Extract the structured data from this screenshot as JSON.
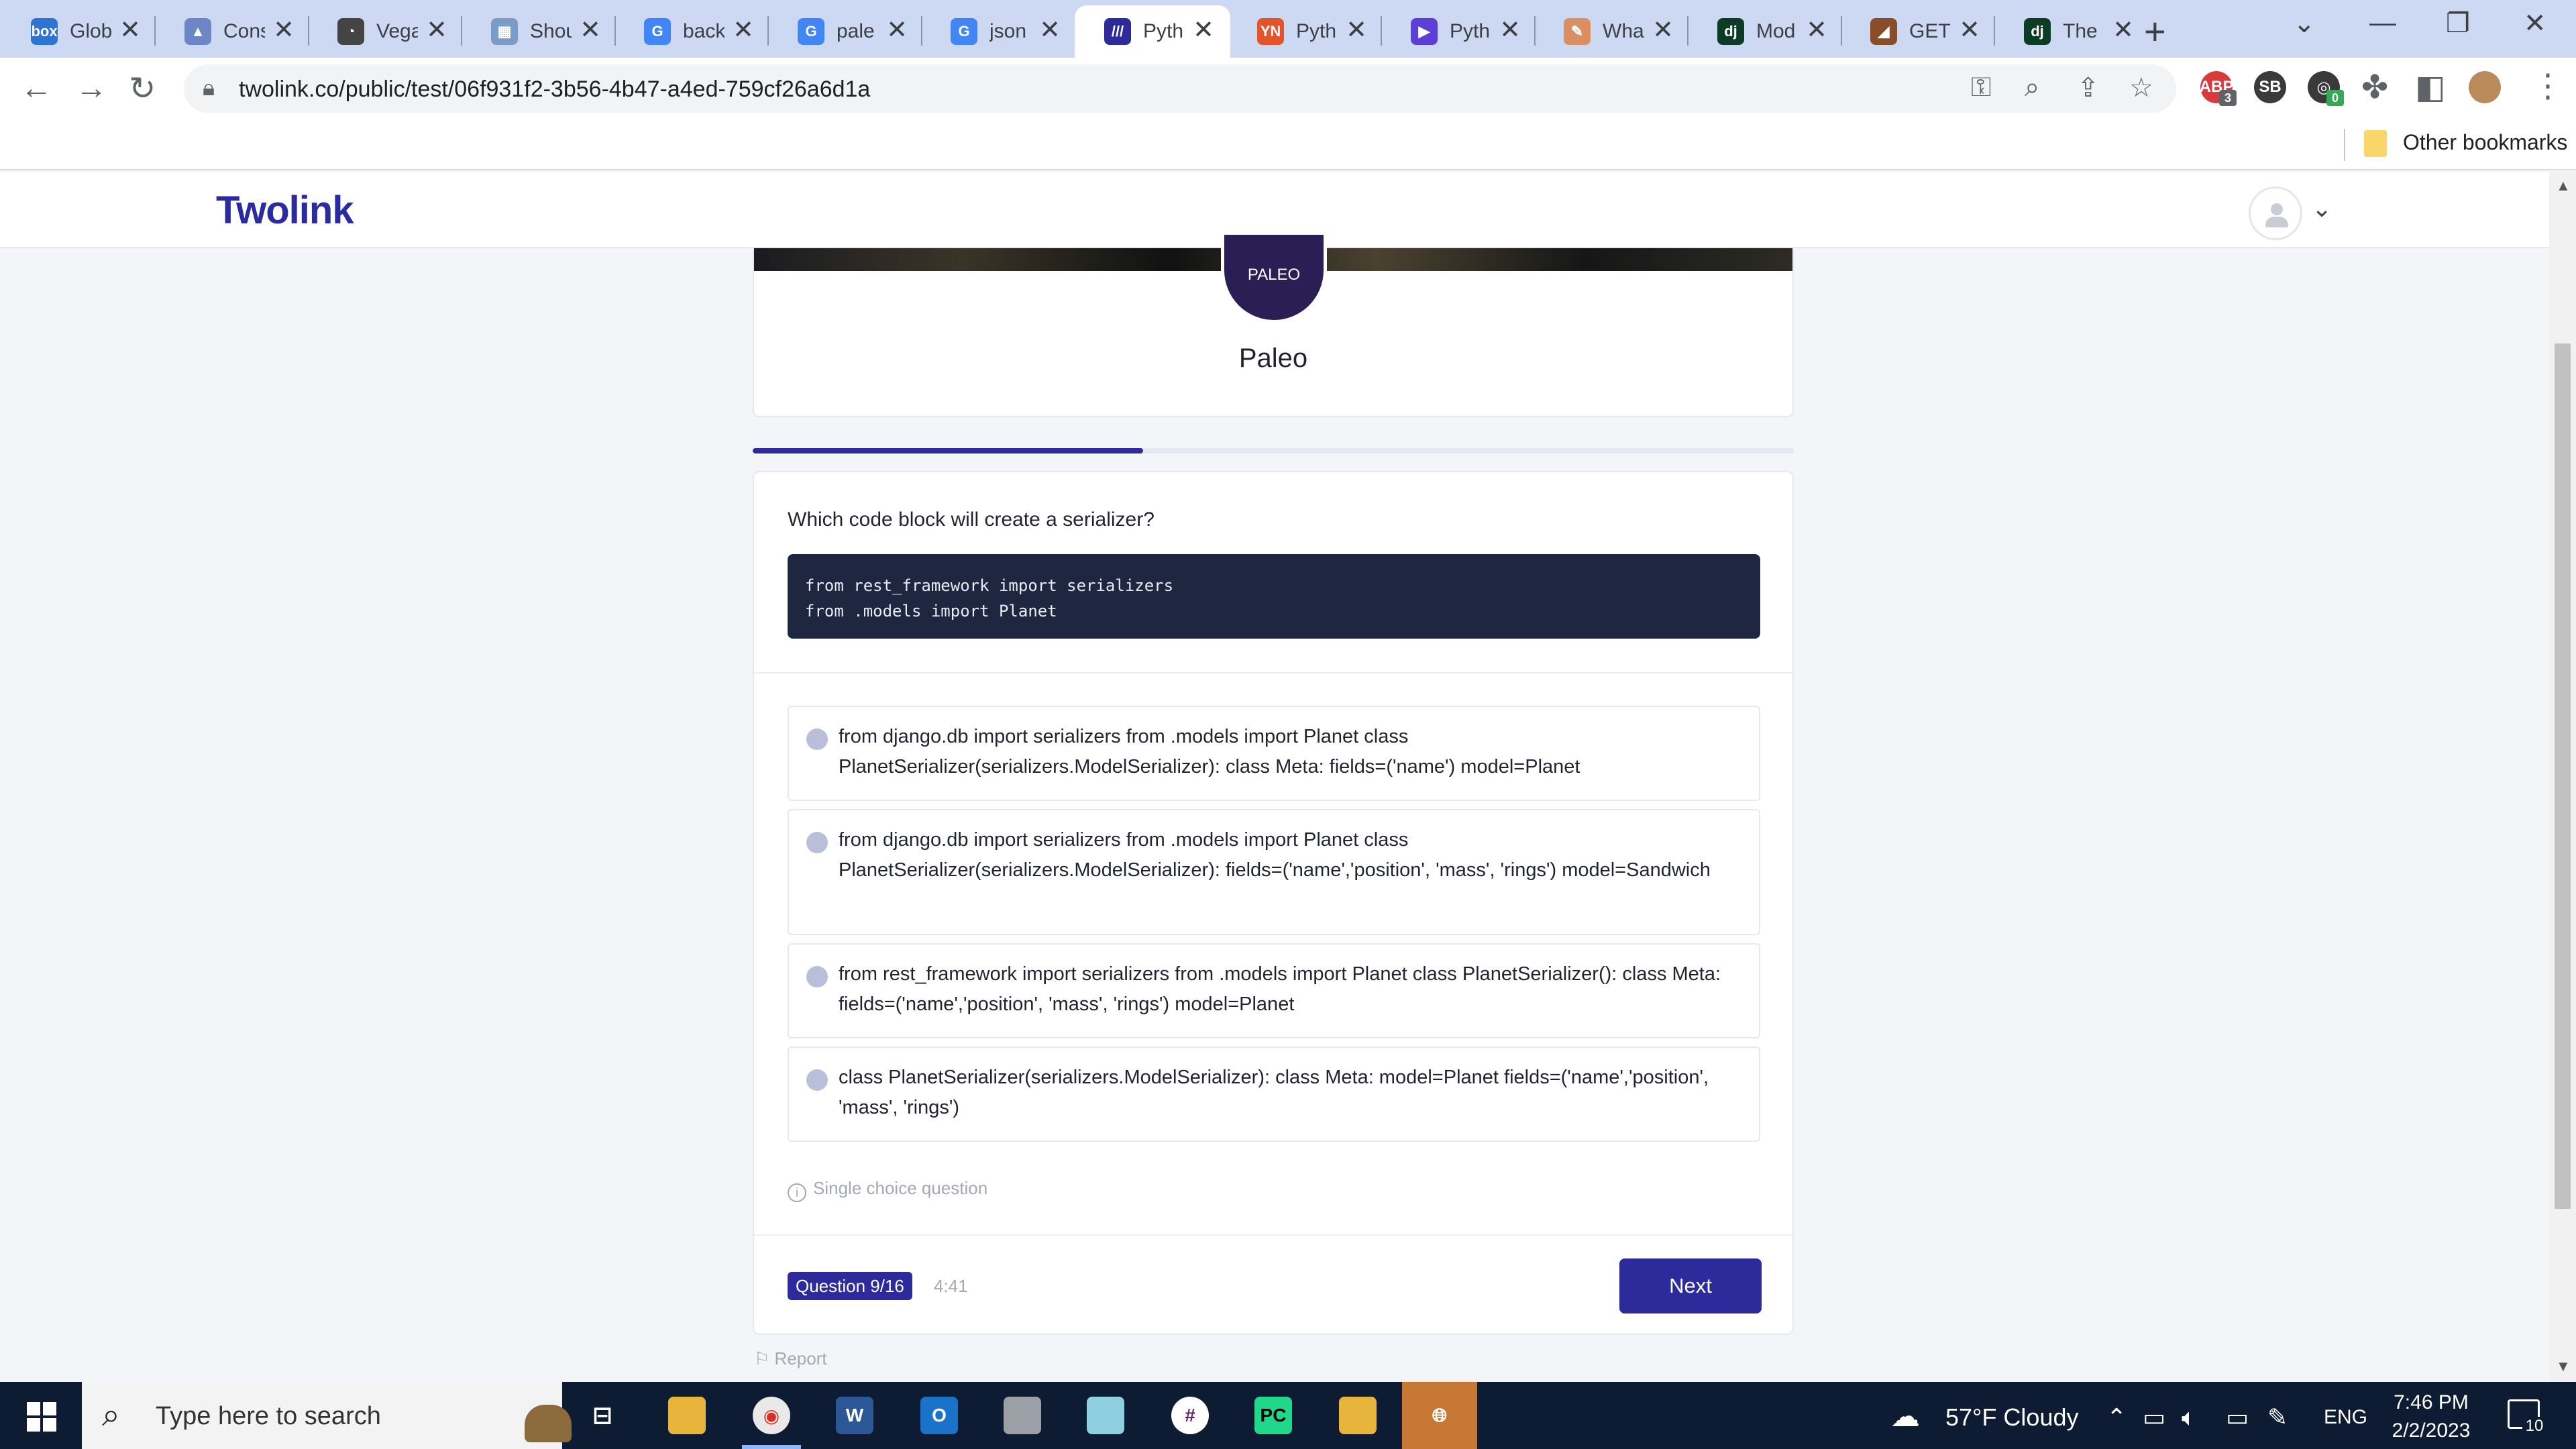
{
  "browser": {
    "tabs": [
      {
        "favicon_text": "box",
        "favicon_color": "#2f74d0",
        "title": "Glob"
      },
      {
        "favicon_text": "▲",
        "favicon_color": "#6d87c6",
        "title": "Cons"
      },
      {
        "favicon_text": "◔",
        "favicon_color": "#444444",
        "title": "Vega"
      },
      {
        "favicon_text": "▦",
        "favicon_color": "#7a9cc8",
        "title": "Shou"
      },
      {
        "favicon_text": "G",
        "favicon_color": "#4285f4",
        "title": "back"
      },
      {
        "favicon_text": "G",
        "favicon_color": "#4285f4",
        "title": "pale"
      },
      {
        "favicon_text": "G",
        "favicon_color": "#4285f4",
        "title": "json"
      },
      {
        "favicon_text": "///",
        "favicon_color": "#2d2b9c",
        "title": "Pyth"
      },
      {
        "favicon_text": "YN",
        "favicon_color": "#e2552b",
        "title": "Pyth"
      },
      {
        "favicon_text": "▶",
        "favicon_color": "#5b3fd6",
        "title": "Pyth"
      },
      {
        "favicon_text": "✎",
        "favicon_color": "#d98f62",
        "title": "What"
      },
      {
        "favicon_text": "dj",
        "favicon_color": "#0c3c26",
        "title": "Mod"
      },
      {
        "favicon_text": "◢",
        "favicon_color": "#8a4d2a",
        "title": "GET"
      },
      {
        "favicon_text": "dj",
        "favicon_color": "#0c3c26",
        "title": "The"
      }
    ],
    "new_tab_label": "+",
    "url": "twolink.co/public/test/06f931f2-3b56-4b47-a4ed-759cf26a6d1a",
    "extensions": [
      {
        "label": "ABP",
        "color": "#d83b3b",
        "badge": "3"
      },
      {
        "label": "SB",
        "color": "#3a3a3a"
      },
      {
        "label": "◎",
        "color": "#3a3a3a",
        "badge": "0"
      }
    ],
    "bookmarks": {
      "other_label": "Other bookmarks"
    }
  },
  "site": {
    "logo": "Twolink",
    "accent": "#2d2b9c"
  },
  "profile": {
    "badge_label": "PALEO",
    "name": "Paleo"
  },
  "progress": {
    "fraction": 0.375
  },
  "question": {
    "prompt": "Which code block will create a serializer?",
    "code": "from rest_framework import serializers\nfrom .models import Planet",
    "options": [
      "from django.db import serializers from .models import Planet class PlanetSerializer(serializers.ModelSerializer): class Meta: fields=('name') model=Planet",
      "from django.db import serializers from .models import Planet class PlanetSerializer(serializers.ModelSerializer): fields=('name','position', 'mass', 'rings') model=Sandwich",
      "from rest_framework import serializers from .models import Planet class PlanetSerializer(): class Meta: fields=('name','position', 'mass', 'rings') model=Planet",
      "class PlanetSerializer(serializers.ModelSerializer): class Meta: model=Planet fields=('name','position', 'mass', 'rings')"
    ],
    "hint": "Single choice question",
    "counter": "Question 9/16",
    "timer": "4:41",
    "next_label": "Next",
    "report_label": "Report"
  },
  "taskbar": {
    "search_placeholder": "Type here to search",
    "weather": "57°F  Cloudy",
    "language": "ENG",
    "time": "7:46 PM",
    "date": "2/2/2023",
    "notification_count": "10"
  }
}
